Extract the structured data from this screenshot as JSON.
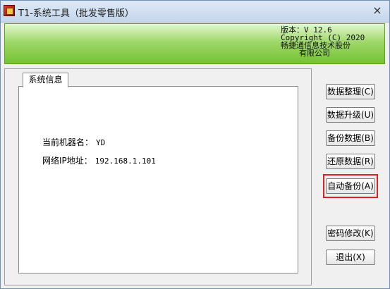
{
  "window": {
    "title": "T1-系统工具（批发零售版）",
    "close_label": "×"
  },
  "banner": {
    "version": "版本：V 12.6",
    "copyright": "Copyright (C) 2020",
    "company_line1": "畅捷通信息技术股份",
    "company_line2": "有限公司"
  },
  "panel": {
    "tab_label": "系统信息",
    "machine_name_label": "当前机器名：",
    "machine_name_value": "YD",
    "ip_label": "网络IP地址：",
    "ip_value": "192.168.1.101"
  },
  "buttons": {
    "data_cleanup": "数据整理(C)",
    "data_upgrade": "数据升级(U)",
    "backup_data": "备份数据(B)",
    "restore_data": "还原数据(R)",
    "auto_backup": "自动备份(A)",
    "change_password": "密码修改(K)",
    "exit": "退出(X)"
  },
  "colors": {
    "banner_green": "#74c232",
    "highlight_red": "#e02020"
  }
}
